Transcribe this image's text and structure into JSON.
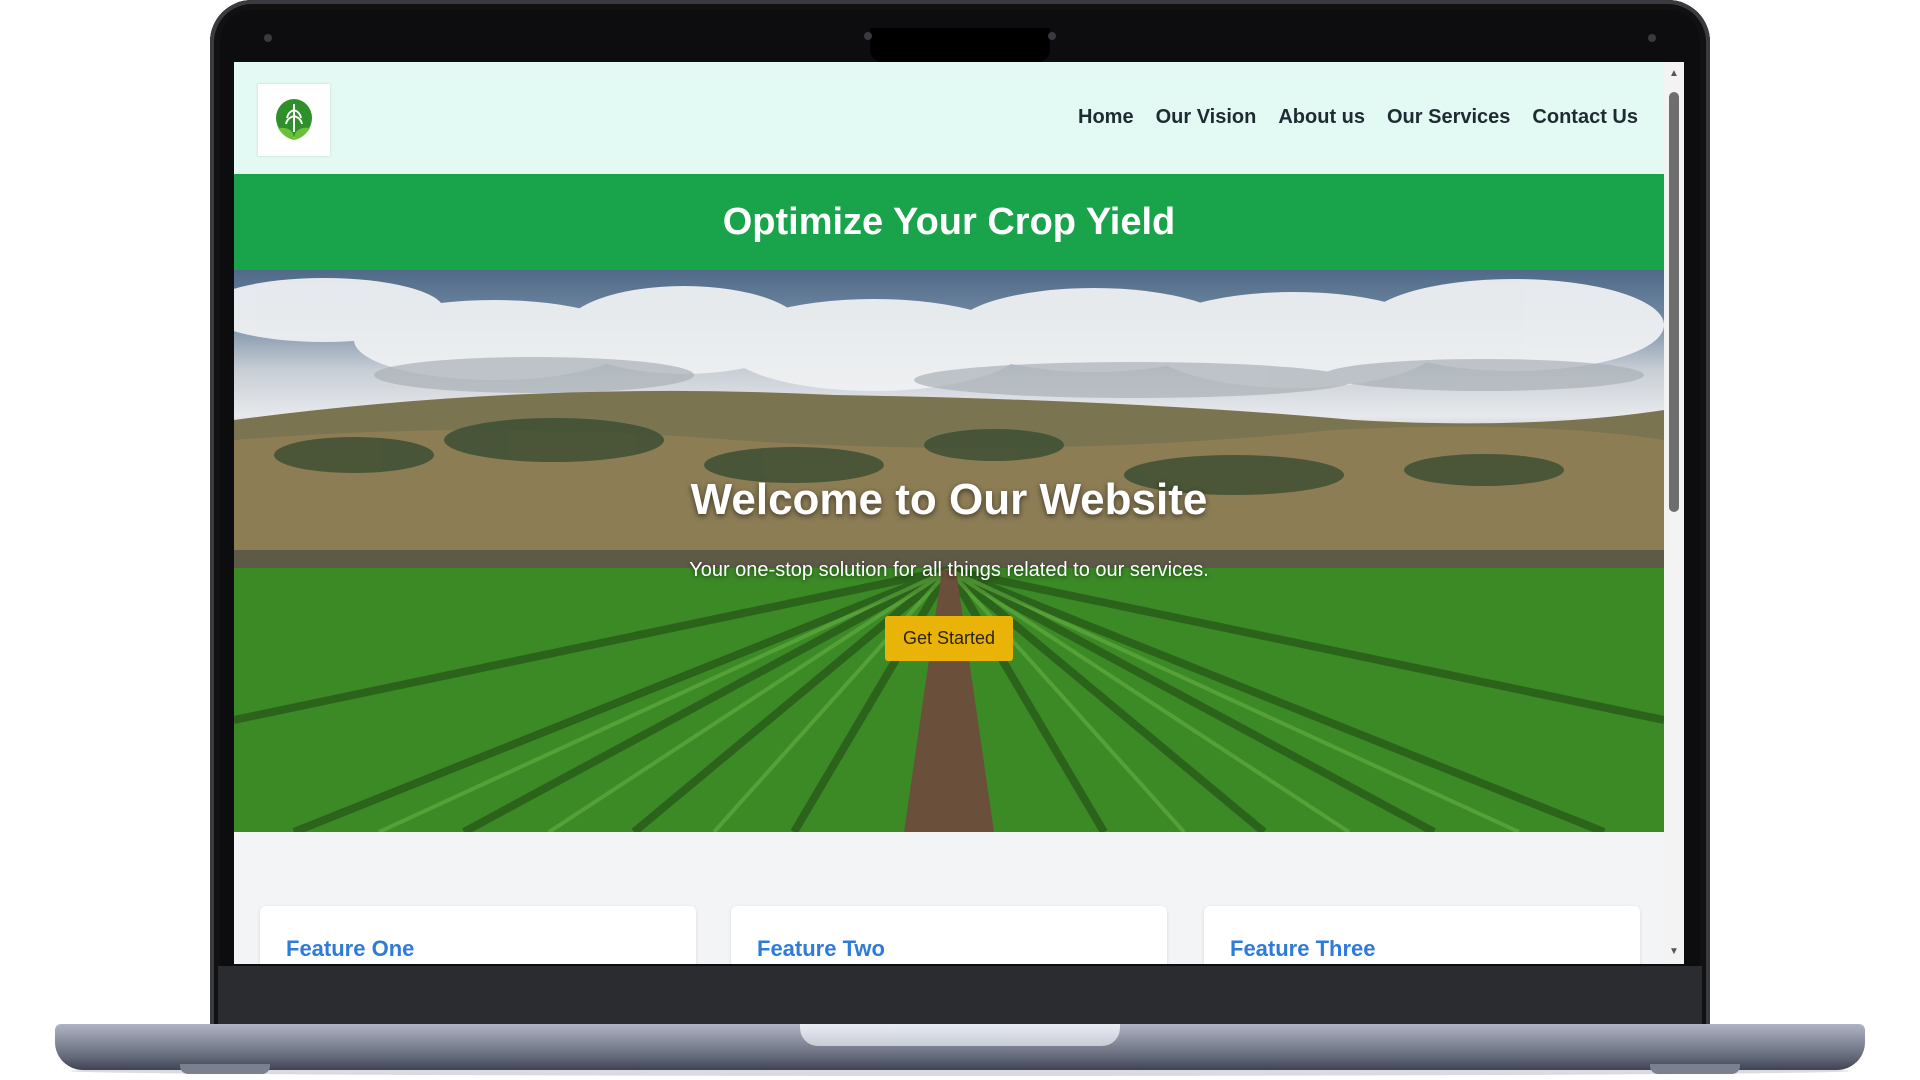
{
  "header": {
    "logo_icon": "wheat-leaf-logo-icon",
    "nav_items": [
      {
        "label": "Home"
      },
      {
        "label": "Our Vision"
      },
      {
        "label": "About us"
      },
      {
        "label": "Our Services"
      },
      {
        "label": "Contact Us"
      }
    ]
  },
  "banner": {
    "title": "Optimize Your Crop Yield",
    "color": "#19a34a"
  },
  "hero": {
    "title": "Welcome to Our Website",
    "subtitle": "Your one-stop solution for all things related to our services.",
    "cta_label": "Get Started",
    "cta_color": "#eab308",
    "background_image": "crop-field-landscape"
  },
  "features": {
    "cards": [
      {
        "title": "Feature One"
      },
      {
        "title": "Feature Two"
      },
      {
        "title": "Feature Three"
      }
    ],
    "title_color": "#2f7bd9"
  },
  "colors": {
    "header_bg": "#e2faf3",
    "nav_text": "#1f2b33"
  }
}
